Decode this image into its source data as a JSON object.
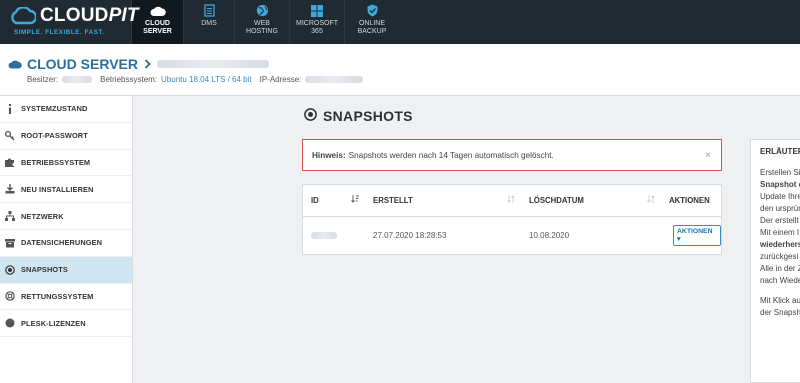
{
  "brand": {
    "name_a": "CLOUD",
    "name_b": "PIT",
    "slogan": "SIMPLE. FLEXIBLE. FAST."
  },
  "nav": {
    "items": [
      {
        "label_1": "CLOUD",
        "label_2": "SERVER",
        "icon": "cloud-icon",
        "active": true
      },
      {
        "label_1": "DMS",
        "label_2": "",
        "icon": "document-icon",
        "active": false
      },
      {
        "label_1": "WEB",
        "label_2": "HOSTING",
        "icon": "globe-icon",
        "active": false
      },
      {
        "label_1": "MICROSOFT",
        "label_2": "365",
        "icon": "windows-icon",
        "active": false
      },
      {
        "label_1": "ONLINE",
        "label_2": "BACKUP",
        "icon": "shield-icon",
        "active": false
      }
    ]
  },
  "server": {
    "title": "CLOUD SERVER",
    "owner_label": "Besitzer:",
    "os_label": "Betriebssystem:",
    "os_value": "Ubuntu 18.04 LTS / 64 bit",
    "ip_label": "IP-Adresse:"
  },
  "sidebar": {
    "items": [
      {
        "label": "SYSTEMZUSTAND",
        "icon": "info-icon"
      },
      {
        "label": "ROOT-PASSWORT",
        "icon": "key-icon"
      },
      {
        "label": "BETRIEBSSYSTEM",
        "icon": "puzzle-icon"
      },
      {
        "label": "NEU INSTALLIEREN",
        "icon": "download-icon"
      },
      {
        "label": "NETZWERK",
        "icon": "network-icon"
      },
      {
        "label": "DATENSICHERUNGEN",
        "icon": "archive-icon"
      },
      {
        "label": "SNAPSHOTS",
        "icon": "snapshot-icon"
      },
      {
        "label": "RETTUNGSSYSTEM",
        "icon": "lifebuoy-icon"
      },
      {
        "label": "PLESK-LIZENZEN",
        "icon": "plesk-icon"
      }
    ]
  },
  "page": {
    "title": "SNAPSHOTS"
  },
  "notice": {
    "bold": "Hinweis:",
    "text": "Snapshots werden nach 14 Tagen automatisch gelöscht.",
    "close": "×"
  },
  "table": {
    "columns": [
      "ID",
      "ERSTELLT",
      "LÖSCHDATUM",
      "AKTIONEN"
    ],
    "rows": [
      {
        "created": "27.07.2020 18:28:53",
        "deleted": "10.08.2020",
        "action": "AKTIONEN ▾"
      }
    ]
  },
  "info": {
    "heading": "ERLÄUTER",
    "lines": [
      "Erstellen Si",
      "Snapshot e",
      "Update Ihre",
      "den ursprün",
      "Der erstellt",
      "Mit einem I",
      "wiederhers",
      "zurückgesi",
      "Alle in der Z",
      "nach Wiede",
      "Mit Klick au",
      "der Snapsh"
    ]
  }
}
